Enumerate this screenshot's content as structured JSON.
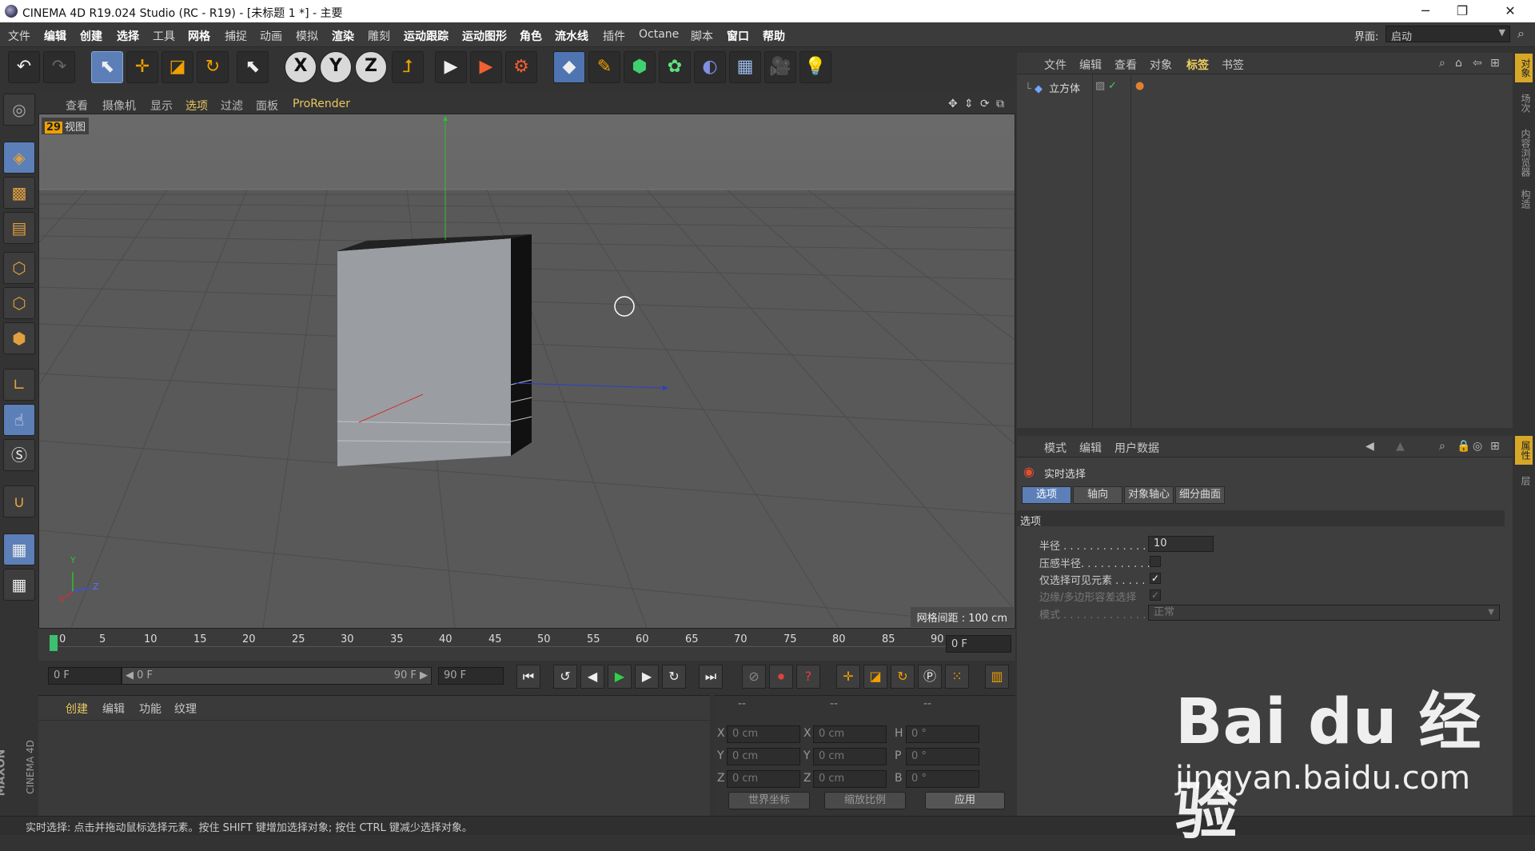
{
  "window": {
    "title": "CINEMA 4D R19.024 Studio (RC - R19) - [未标题 1 *] - 主要",
    "minimize": "─",
    "restore": "❐",
    "close": "✕"
  },
  "menubar": {
    "items": [
      "文件",
      "编辑",
      "创建",
      "选择",
      "工具",
      "网格",
      "捕捉",
      "动画",
      "模拟",
      "渲染",
      "雕刻",
      "运动跟踪",
      "运动图形",
      "角色",
      "流水线",
      "插件",
      "Octane",
      "脚本",
      "窗口",
      "帮助"
    ],
    "layout_label": "界面:",
    "layout_value": "启动"
  },
  "viewport": {
    "menus": [
      "查看",
      "摄像机",
      "显示",
      "选项",
      "过滤",
      "面板",
      "ProRender"
    ],
    "fps": "29",
    "label": "视图",
    "grid_spacing": "网格间距 : 100 cm",
    "axis_y": "Y",
    "axis_z": "Z",
    "axis_x": "X"
  },
  "timeline": {
    "ticks": [
      "0",
      "5",
      "10",
      "15",
      "20",
      "25",
      "30",
      "35",
      "40",
      "45",
      "50",
      "55",
      "60",
      "65",
      "70",
      "75",
      "80",
      "85",
      "90"
    ],
    "current_frame": "0 F"
  },
  "transport": {
    "start": "0 F",
    "range_start": "◀ 0 F",
    "range_end": "90 F ▶",
    "end": "90 F"
  },
  "material_manager": {
    "menus": [
      "创建",
      "编辑",
      "功能",
      "纹理"
    ]
  },
  "coordinates": {
    "headers": [
      "--",
      "--",
      "--"
    ],
    "rows": [
      {
        "l1": "X",
        "v1": "0 cm",
        "l2": "X",
        "v2": "0 cm",
        "l3": "H",
        "v3": "0 °"
      },
      {
        "l1": "Y",
        "v1": "0 cm",
        "l2": "Y",
        "v2": "0 cm",
        "l3": "P",
        "v3": "0 °"
      },
      {
        "l1": "Z",
        "v1": "0 cm",
        "l2": "Z",
        "v2": "0 cm",
        "l3": "B",
        "v3": "0 °"
      }
    ],
    "world_coords": "世界坐标",
    "scale_ratio": "缩放比例",
    "apply": "应用"
  },
  "object_manager": {
    "menus": [
      "文件",
      "编辑",
      "查看",
      "对象",
      "标签",
      "书签"
    ],
    "objects": [
      "立方体"
    ]
  },
  "attribute_manager": {
    "menus": [
      "模式",
      "编辑",
      "用户数据"
    ],
    "tool_name": "实时选择",
    "tabs": [
      "选项",
      "轴向",
      "对象轴心",
      "细分曲面"
    ],
    "section": "选项",
    "fields": {
      "radius_label": "半径 . . . . . . . . . . . . . .",
      "radius_value": "10",
      "pressure_label": "压感半径. . . . . . . . . . .",
      "visible_only_label": "仅选择可见元素 . . . . .",
      "edge_poly_label": "边缘/多边形容差选择",
      "mode_label": "模式 . . . . . . . . . . . . . .",
      "mode_value": "正常"
    }
  },
  "right_tabs": [
    "对象",
    "场次",
    "内容浏览器",
    "构造",
    "属性",
    "层"
  ],
  "status": "实时选择: 点击并拖动鼠标选择元素。按住 SHIFT 键增加选择对象; 按住 CTRL 键减少选择对象。",
  "brand": {
    "maxon": "MAXON",
    "c4d": "CINEMA 4D"
  },
  "watermark": {
    "logo": "Bai du 经验",
    "url": "jingyan.baidu.com"
  }
}
